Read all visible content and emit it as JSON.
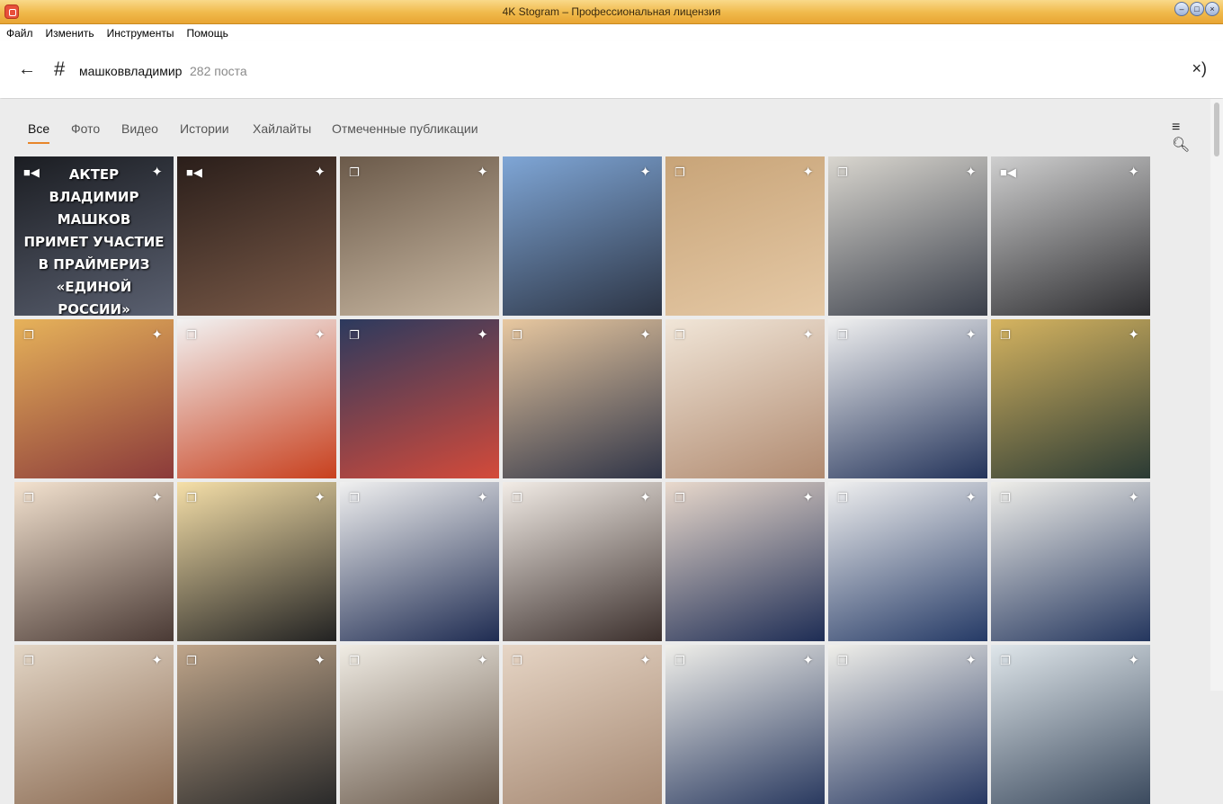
{
  "window": {
    "title": "4K Stogram – Профессиональная лицензия"
  },
  "menu": [
    "Файл",
    "Изменить",
    "Инструменты",
    "Помощь"
  ],
  "header": {
    "hashtag": "машковвладимир",
    "post_count": "282 поста"
  },
  "tabs": [
    "Все",
    "Фото",
    "Видео",
    "Истории",
    "Хайлайты",
    "Отмеченные публикации"
  ],
  "active_tab": "Все",
  "first_post_caption": "АКТЕР ВЛАДИМИР МАШКОВ ПРИМЕТ УЧАСТИЕ В ПРАЙМЕРИЗ «ЕДИНОЙ РОССИИ»",
  "grid": {
    "columns": 7,
    "tiles": [
      {
        "type": "video",
        "colors": [
          "#1b1d22",
          "#5a6070"
        ]
      },
      {
        "type": "video",
        "colors": [
          "#2a1e1a",
          "#7a5a48"
        ]
      },
      {
        "type": "album",
        "colors": [
          "#6b5a4a",
          "#c9b8a2"
        ]
      },
      {
        "type": "photo",
        "colors": [
          "#7fa6d6",
          "#2c3444"
        ]
      },
      {
        "type": "album",
        "colors": [
          "#c8a478",
          "#e5c9a6"
        ]
      },
      {
        "type": "album",
        "colors": [
          "#d9d6cf",
          "#3a3f4a"
        ]
      },
      {
        "type": "video",
        "colors": [
          "#cfcfcf",
          "#2d2d30"
        ]
      },
      {
        "type": "album",
        "colors": [
          "#e6b25a",
          "#8b3a3a"
        ]
      },
      {
        "type": "album",
        "colors": [
          "#f2f2f2",
          "#c8401e"
        ]
      },
      {
        "type": "album",
        "colors": [
          "#2c3a5e",
          "#d44a3a"
        ]
      },
      {
        "type": "album",
        "colors": [
          "#e8c8a0",
          "#2f3447"
        ]
      },
      {
        "type": "album",
        "colors": [
          "#f1e6d8",
          "#b08a70"
        ]
      },
      {
        "type": "album",
        "colors": [
          "#f0f0f0",
          "#23335a"
        ]
      },
      {
        "type": "album",
        "colors": [
          "#d6b460",
          "#2a3a34"
        ]
      },
      {
        "type": "album",
        "colors": [
          "#f3e2cf",
          "#4a3a35"
        ]
      },
      {
        "type": "album",
        "colors": [
          "#f5dfa8",
          "#222222"
        ]
      },
      {
        "type": "album",
        "colors": [
          "#f0f0f0",
          "#1f2c52"
        ]
      },
      {
        "type": "album",
        "colors": [
          "#f2ece6",
          "#3b2f2c"
        ]
      },
      {
        "type": "album",
        "colors": [
          "#e9d9cc",
          "#1e2d55"
        ]
      },
      {
        "type": "album",
        "colors": [
          "#f0f0f0",
          "#253a66"
        ]
      },
      {
        "type": "album",
        "colors": [
          "#f0efea",
          "#24365e"
        ]
      },
      {
        "type": "album",
        "colors": [
          "#e3d6c6",
          "#8a6a52"
        ]
      },
      {
        "type": "album",
        "colors": [
          "#bfa58a",
          "#2a2a2a"
        ]
      },
      {
        "type": "album",
        "colors": [
          "#f0ece4",
          "#6a5a4c"
        ]
      },
      {
        "type": "album",
        "colors": [
          "#e6d5c5",
          "#a58872"
        ]
      },
      {
        "type": "album",
        "colors": [
          "#f0efea",
          "#2a3a60"
        ]
      },
      {
        "type": "album",
        "colors": [
          "#f0efea",
          "#273862"
        ]
      },
      {
        "type": "album",
        "colors": [
          "#dfe6ea",
          "#3b4a5e"
        ]
      }
    ]
  }
}
